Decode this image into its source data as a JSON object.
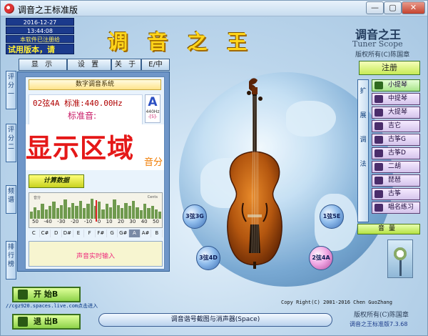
{
  "window": {
    "title": "调音之王标准版",
    "min_label": "—",
    "max_label": "▢",
    "close_label": "✕"
  },
  "status": {
    "date": "2016-12-27",
    "time": "13:44:08",
    "registration": "本软件已注册给",
    "trial": "试用版本，请"
  },
  "header": {
    "big_title": "调 音 之 王",
    "brand_title": "调音之王",
    "brand_sub": "Tuner Scope",
    "brand_copy": "版权所有(C)陈国章"
  },
  "menu": [
    "显 示",
    "设 置",
    "关 于",
    "E/中"
  ],
  "register_button": "注册",
  "left_tabs": [
    {
      "label": "评分一",
      "chars": [
        "评",
        "分",
        "一"
      ]
    },
    {
      "label": "评分二",
      "chars": [
        "评",
        "分",
        "二"
      ]
    },
    {
      "label": "频谱",
      "chars": [
        "频",
        "谱"
      ]
    },
    {
      "label": "排行榜",
      "chars": [
        "排",
        "行",
        "榜"
      ]
    }
  ],
  "panel": {
    "system_title": "数字调音系统",
    "readout_line1": "02弦4A 标准:440.00Hz",
    "readout_line2": "标准音:",
    "note_letter": "A",
    "note_hz": "440Hz",
    "note_octave": "-[5]-",
    "display_big": "显示区域",
    "display_small": "音分",
    "calc_button": "计算数据",
    "meter_left": "音分",
    "meter_right": "Cents",
    "meter_ticks": [
      "50",
      "-40",
      "-30",
      "-20",
      "-10",
      "0",
      "10",
      "20",
      "30",
      "40",
      "50"
    ],
    "meter_levels": [
      0.35,
      0.55,
      0.4,
      0.7,
      0.45,
      0.6,
      0.8,
      0.5,
      0.65,
      0.9,
      0.55,
      0.75,
      0.6,
      0.85,
      0.5,
      0.7,
      0.95,
      0.6,
      0.8,
      0.45,
      0.7,
      0.55,
      0.9,
      0.65,
      0.5,
      0.75,
      0.6,
      0.85,
      0.55,
      0.4,
      0.7,
      0.5,
      0.6,
      0.45,
      0.35
    ],
    "keys": [
      "C",
      "C#",
      "D",
      "D#",
      "E",
      "F",
      "F#",
      "G",
      "G#",
      "A",
      "A#",
      "B"
    ],
    "active_key_index": 9,
    "input_text": "声音实时输入"
  },
  "strings": [
    {
      "label": "3弦3G",
      "style": "blue"
    },
    {
      "label": "1弦5E",
      "style": "blue"
    },
    {
      "label": "3弦4D",
      "style": "blue"
    },
    {
      "label": "2弦4A",
      "style": "pink"
    }
  ],
  "right": {
    "ext_chars": [
      "扩",
      "展",
      "调",
      "法"
    ],
    "instruments": [
      "小提琴",
      "中提琴",
      "大提琴",
      "吉它",
      "古筝G",
      "古筝D",
      "二胡",
      "琵琶",
      "古筝",
      "唱名练习"
    ],
    "volume": "音量"
  },
  "footer": {
    "copyright": "Copy Right(C) 2001-2016 Chen GuoZhang",
    "footer_copy": "版权所有(C)陈国章",
    "version": "调音之王标准版7.3.68",
    "start_button": "开 始B",
    "exit_button": "退 出B",
    "link": "//cgz920.spaces.live.com点击进入",
    "scan_bar": "调音谐号截图与消声器(Space)"
  },
  "colors": {
    "accent": "#1b3a8c",
    "title_gold": "#ffd51a",
    "display_red": "#e51818"
  }
}
